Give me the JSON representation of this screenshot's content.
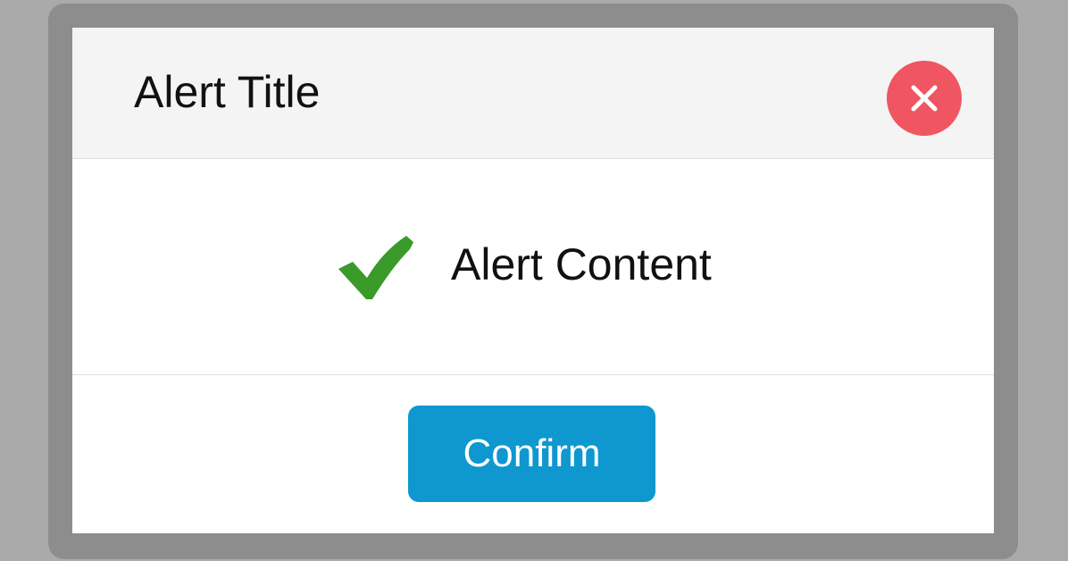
{
  "dialog": {
    "title": "Alert Title",
    "content": "Alert Content",
    "confirm_label": "Confirm",
    "close_icon": "close-icon",
    "status_icon": "check-icon"
  },
  "colors": {
    "backdrop": "#aaaaaa",
    "frame": "#8d8d8d",
    "header_bg": "#f4f4f5",
    "close_button": "#f05562",
    "check_icon": "#3a9a2a",
    "confirm_button": "#0e98cf"
  }
}
